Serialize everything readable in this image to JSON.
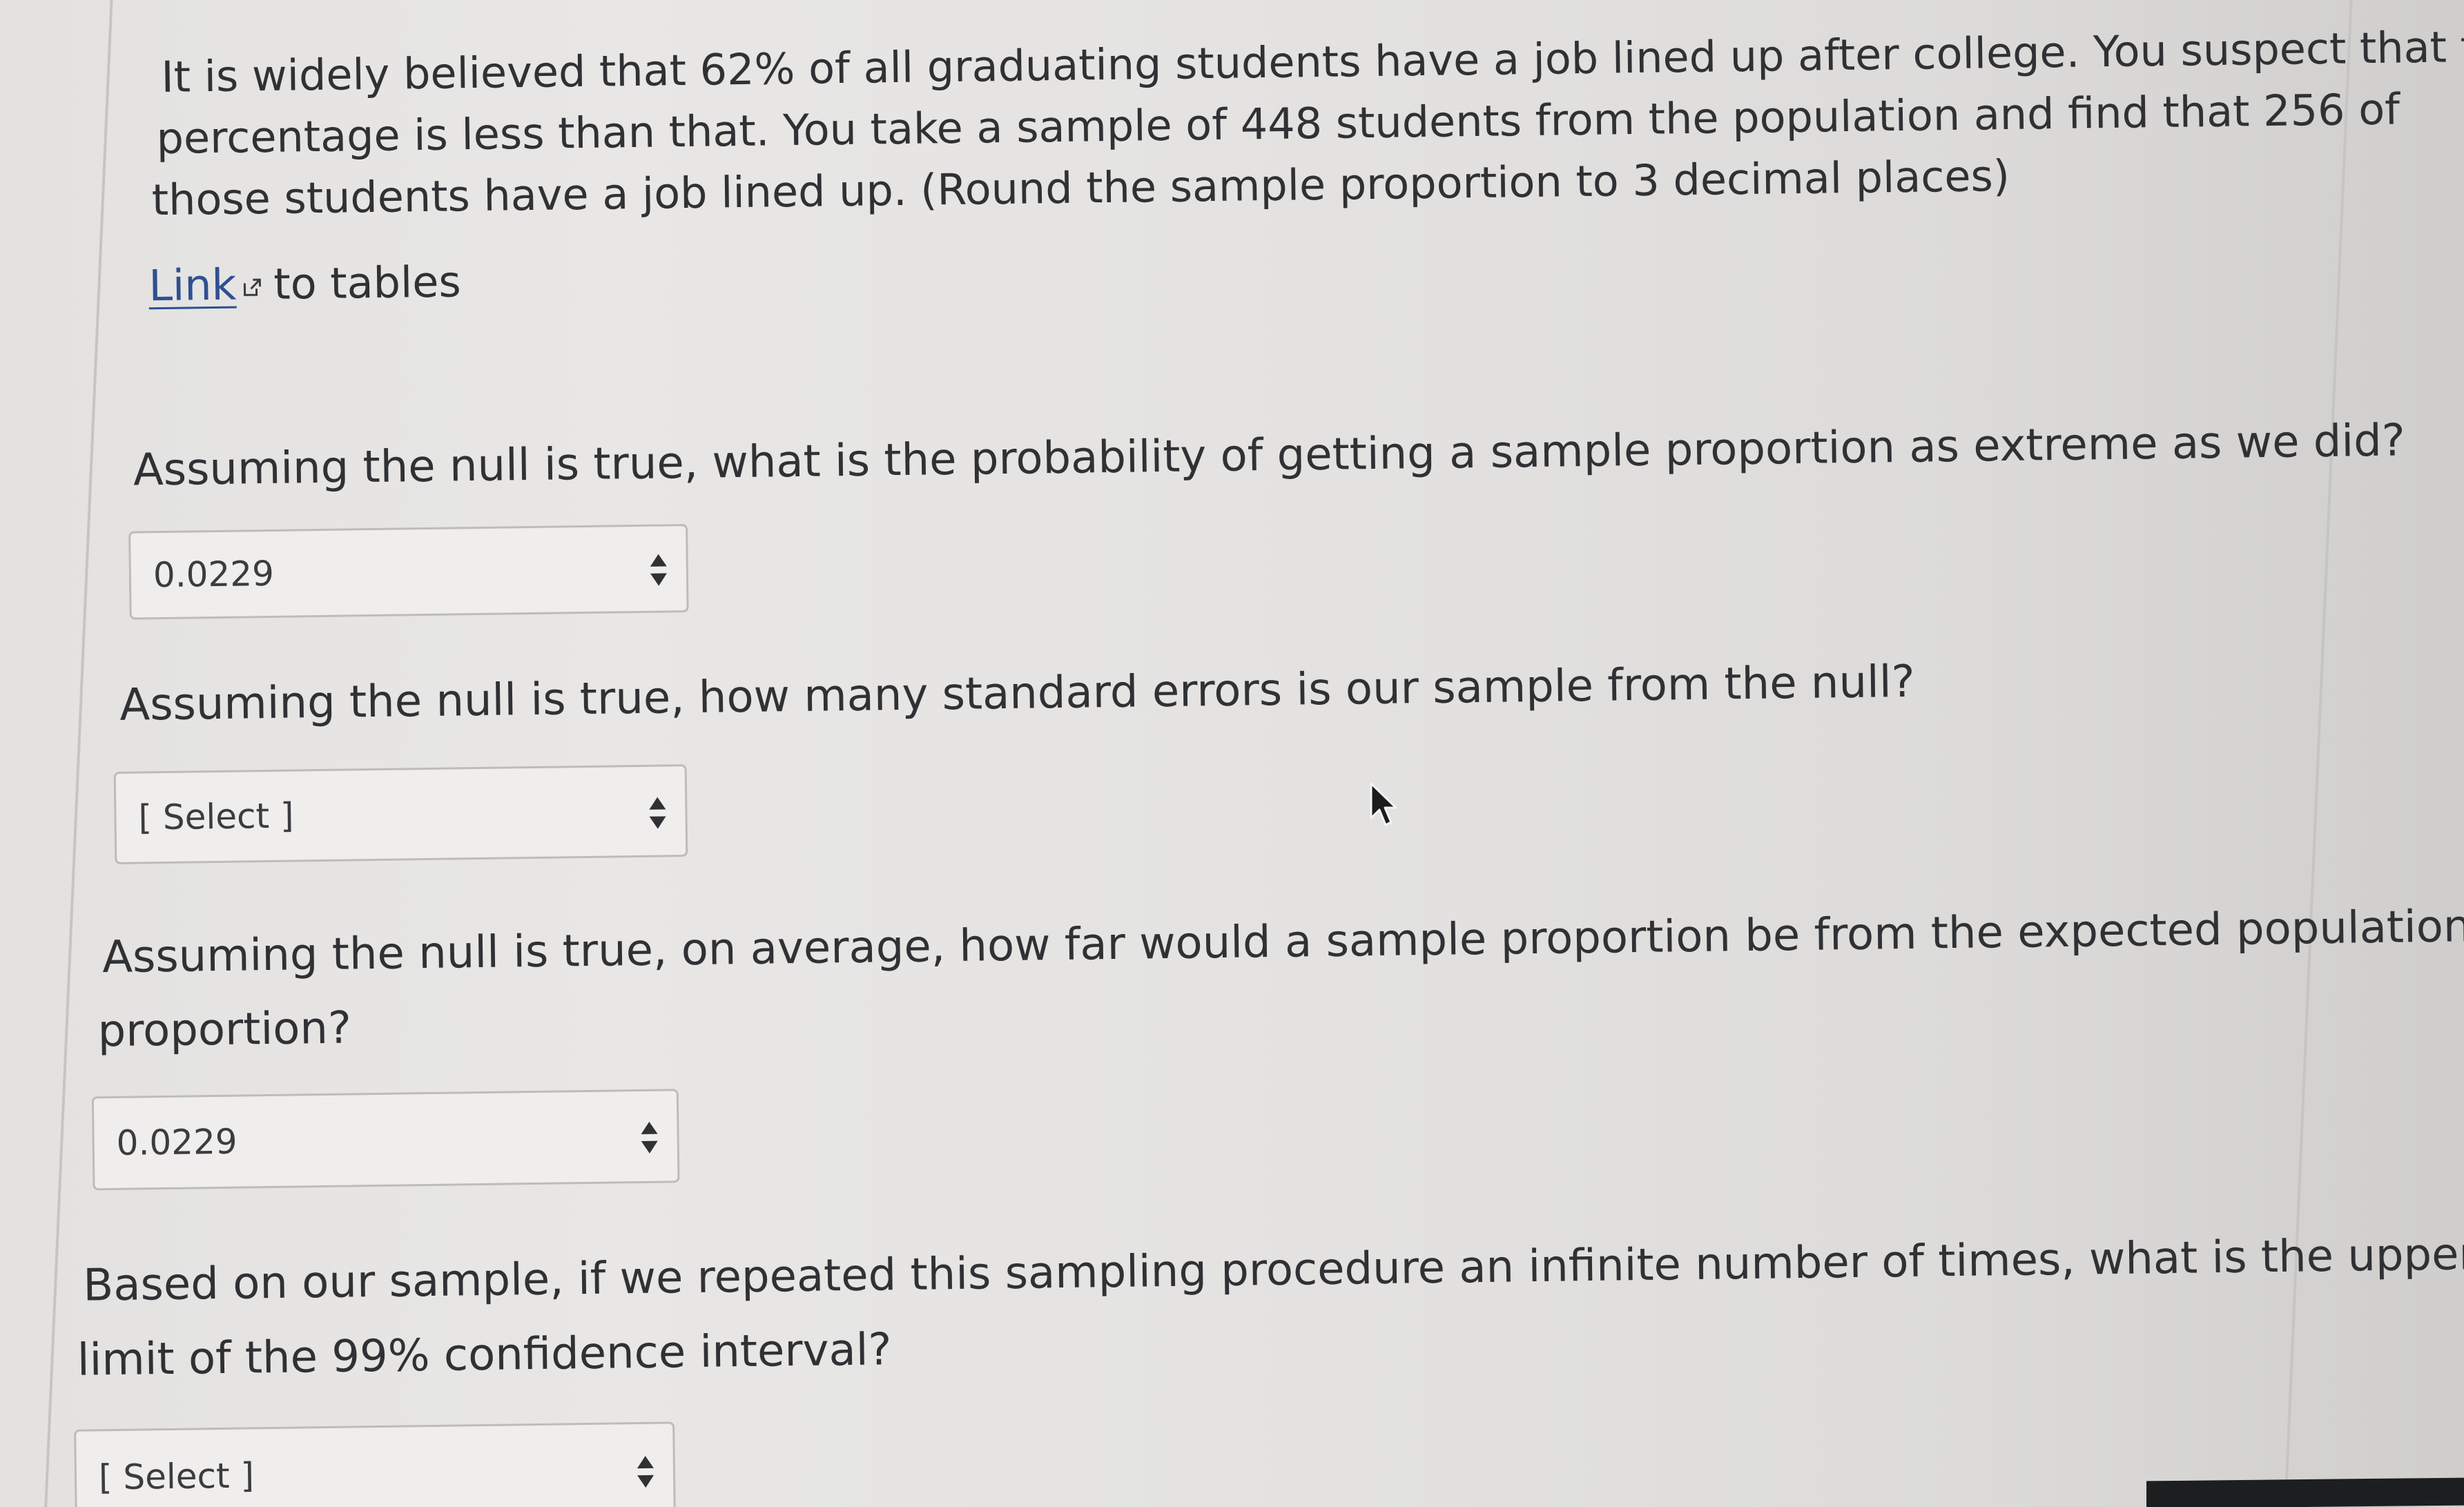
{
  "intro": {
    "line1": "It is widely believed that 62% of all graduating students have a job lined up after college. You suspect that the",
    "line2": "percentage is less than that. You take a sample of 448 students from the population and find that 256 of",
    "line3": "those students have a job lined up. (Round the sample proportion to 3 decimal places)"
  },
  "tables_link": {
    "link_text": "Link",
    "rest_text": "to tables",
    "icon": "external-link-icon"
  },
  "questions": [
    {
      "lines": [
        "Assuming the null is true, what is the probability of getting a sample proportion as extreme as we did?"
      ],
      "selected": "0.0229"
    },
    {
      "lines": [
        "Assuming the null is true, how many standard errors is our sample from the null?"
      ],
      "selected": "[ Select ]"
    },
    {
      "lines": [
        "Assuming the null is true, on average, how far would a sample proportion be from the expected population",
        "proportion?"
      ],
      "selected": "0.0229"
    },
    {
      "lines": [
        "Based on our sample, if we repeated this sampling procedure an infinite number of times, what is the upper",
        "limit of the 99% confidence interval?"
      ],
      "selected": "[ Select ]"
    }
  ],
  "colors": {
    "text": "#2f3134",
    "link": "#2e4f92",
    "select_bg": "#efeeec",
    "select_border": "#bdbcba"
  },
  "icons": {
    "select_arrows": "sort-arrows-icon",
    "cursor": "mouse-pointer-icon"
  }
}
